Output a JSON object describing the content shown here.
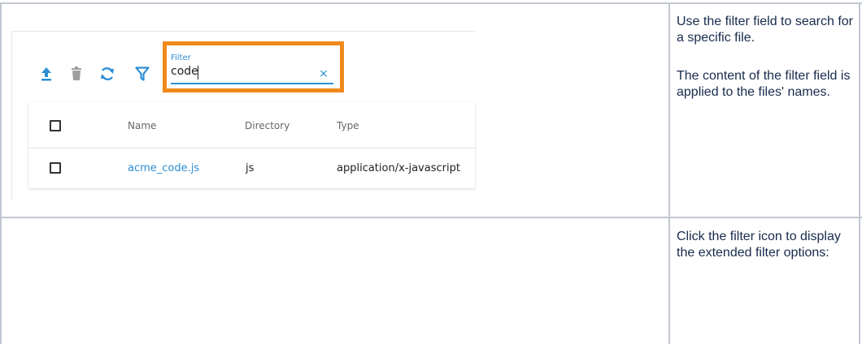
{
  "screenshot": {
    "toolbar": {
      "upload_icon": "upload-icon",
      "delete_icon": "trash-icon",
      "refresh_icon": "refresh-icon",
      "filter_icon": "filter-icon"
    },
    "filter": {
      "label": "Filter",
      "value": "code",
      "clear": "×"
    },
    "table": {
      "headers": [
        "Name",
        "Directory",
        "Type"
      ],
      "rows": [
        {
          "name": "acme_code.js",
          "directory": "js",
          "type": "application/x-javascript"
        }
      ]
    }
  },
  "descriptions": {
    "row1": {
      "p1": "Use the filter field to search for a specific file.",
      "p2": "The content of the filter field is applied to the files' names."
    },
    "row2": {
      "p1": "Click the filter icon to display the extended filter options:"
    }
  },
  "colors": {
    "accent": "#2d8fd5",
    "highlight": "#f08a1c",
    "grid": "#c1c7d0"
  }
}
